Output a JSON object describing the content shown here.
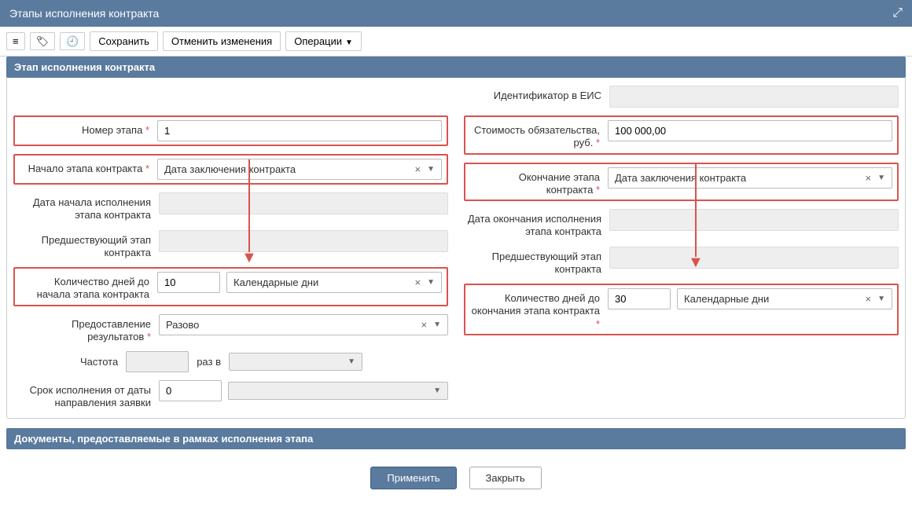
{
  "titlebar": {
    "title": "Этапы исполнения контракта"
  },
  "toolbar": {
    "save": "Сохранить",
    "cancel": "Отменить изменения",
    "ops": "Операции"
  },
  "section_stage": "Этап исполнения контракта",
  "section_docs": "Документы, предоставляемые в рамках исполнения этапа",
  "labels": {
    "eis_id": "Идентификатор в ЕИС",
    "stage_no": "Номер этапа",
    "cost": "Стоимость обязательства, руб.",
    "start": "Начало этапа контракта",
    "end": "Окончание этапа контракта",
    "exec_start": "Дата начала исполнения этапа контракта",
    "exec_end": "Дата окончания исполнения этапа контракта",
    "prev_stage": "Предшествующий этап контракта",
    "days_start": "Количество дней до начала этапа контракта",
    "days_end": "Количество дней до окончания этапа контракта",
    "results": "Предоставление результатов",
    "freq": "Частота",
    "times_in": "раз в",
    "exec_from_req": "Срок исполнения от даты направления заявки"
  },
  "values": {
    "stage_no": "1",
    "cost": "100 000,00",
    "start_sel": "Дата заключения контракта",
    "end_sel": "Дата заключения контракта",
    "days_start": "10",
    "days_start_sel": "Календарные дни",
    "days_end": "30",
    "days_end_sel": "Календарные дни",
    "results_sel": "Разово",
    "exec_from_req": "0"
  },
  "buttons": {
    "apply": "Применить",
    "close": "Закрыть"
  }
}
